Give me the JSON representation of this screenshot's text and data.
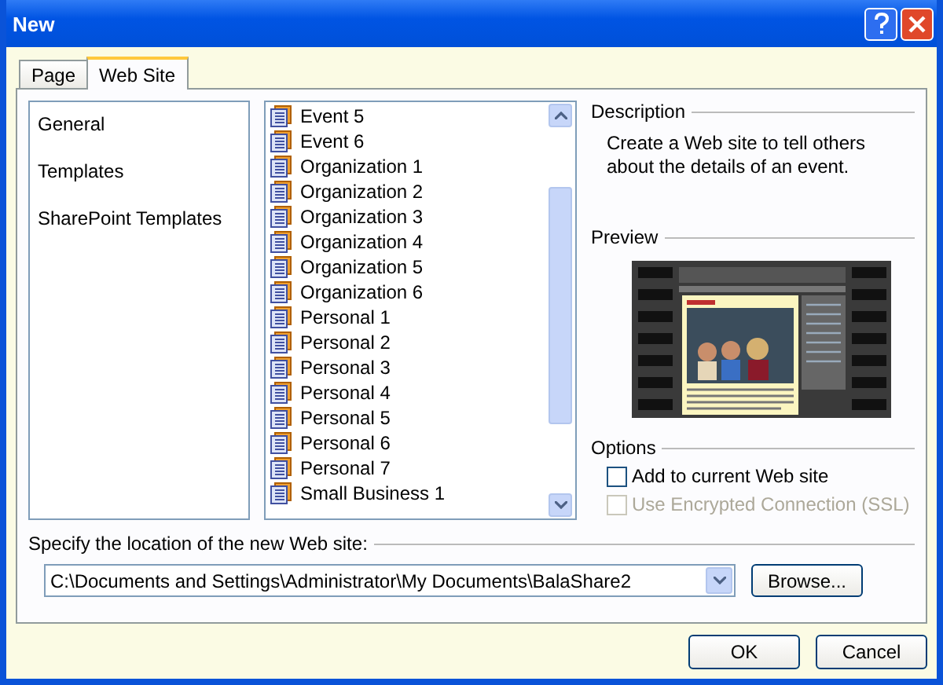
{
  "window": {
    "title": "New"
  },
  "tabs": [
    {
      "label": "Page",
      "selected": false
    },
    {
      "label": "Web Site",
      "selected": true
    }
  ],
  "categories": [
    {
      "label": "General",
      "selected": false
    },
    {
      "label": "Templates",
      "selected": false
    },
    {
      "label": "SharePoint Templates",
      "selected": false
    }
  ],
  "templates": [
    {
      "label": "Event 5",
      "selected": false
    },
    {
      "label": "Event 6",
      "selected": false
    },
    {
      "label": "Organization 1",
      "selected": false
    },
    {
      "label": "Organization 2",
      "selected": false
    },
    {
      "label": "Organization 3",
      "selected": false
    },
    {
      "label": "Organization 4",
      "selected": false
    },
    {
      "label": "Organization 5",
      "selected": false
    },
    {
      "label": "Organization 6",
      "selected": false
    },
    {
      "label": "Personal 1",
      "selected": false
    },
    {
      "label": "Personal 2",
      "selected": false
    },
    {
      "label": "Personal 3",
      "selected": false
    },
    {
      "label": "Personal 4",
      "selected": false
    },
    {
      "label": "Personal 5",
      "selected": false
    },
    {
      "label": "Personal 6",
      "selected": false
    },
    {
      "label": "Personal 7",
      "selected": false
    },
    {
      "label": "Small Business 1",
      "selected": false
    }
  ],
  "description": {
    "heading": "Description",
    "text": "Create a Web site to tell others about the details of an event."
  },
  "preview": {
    "heading": "Preview"
  },
  "options": {
    "heading": "Options",
    "items": [
      {
        "label": "Add to current Web site",
        "checked": false,
        "disabled": false
      },
      {
        "label": "Use Encrypted Connection (SSL)",
        "checked": false,
        "disabled": true
      }
    ]
  },
  "location": {
    "label": "Specify the location of the new Web site:",
    "value": "C:\\Documents and Settings\\Administrator\\My Documents\\BalaShare2",
    "button": "Browse..."
  },
  "buttons": [
    "OK",
    "Cancel"
  ]
}
